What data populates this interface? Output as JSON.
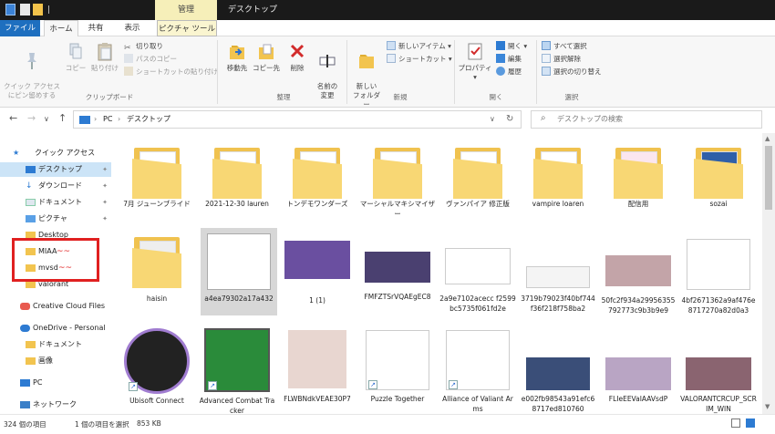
{
  "window": {
    "title": "デスクトップ",
    "context_tab": "管理"
  },
  "tabs": {
    "file": "ファイル",
    "home": "ホーム",
    "share": "共有",
    "view": "表示",
    "picture_tools": "ピクチャ ツール"
  },
  "ribbon": {
    "pin_quick_access": "クイック アクセス\nにピン留めする",
    "copy": "コピー",
    "paste": "貼り付け",
    "cut": "切り取り",
    "copy_path": "パスのコピー",
    "paste_shortcut": "ショートカットの貼り付け",
    "group_clipboard": "クリップボード",
    "move_to": "移動先",
    "copy_to": "コピー先",
    "delete": "削除",
    "rename": "名前の\n変更",
    "group_organize": "整理",
    "new_folder": "新しい\nフォルダー",
    "new_item": "新しいアイテム",
    "shortcut": "ショートカット",
    "group_new": "新規",
    "properties": "プロパティ",
    "open": "開く",
    "edit": "編集",
    "history": "履歴",
    "group_open": "開く",
    "select_all": "すべて選択",
    "select_none": "選択解除",
    "invert_selection": "選択の切り替え",
    "group_select": "選択"
  },
  "address": {
    "crumbs": [
      "PC",
      "デスクトップ"
    ],
    "search_placeholder": "デスクトップの検索"
  },
  "nav": {
    "quick_access": "クイック アクセス",
    "desktop": "デスクトップ",
    "downloads": "ダウンロード",
    "documents": "ドキュメント",
    "pictures": "ピクチャ",
    "desktop_en": "Desktop",
    "miaa": "MIAA",
    "mvsd": "mvsd",
    "valorant": "valorant",
    "creative_cloud": "Creative Cloud Files",
    "onedrive": "OneDrive - Personal",
    "od_documents": "ドキュメント",
    "od_pictures": "画像",
    "pc": "PC",
    "network": "ネットワーク"
  },
  "items": [
    {
      "label": "7月 ジューンブライド"
    },
    {
      "label": "2021-12-30 lauren"
    },
    {
      "label": "トンデモワンダーズ"
    },
    {
      "label": "マーシャルマキシマイザー"
    },
    {
      "label": "ヴァンパイア 修正版"
    },
    {
      "label": "vampire loaren"
    },
    {
      "label": "配信用"
    },
    {
      "label": "sozai"
    },
    {
      "label": "haisin"
    },
    {
      "label": "a4ea79302a17a432"
    },
    {
      "label": "1 (1)"
    },
    {
      "label": "FMFZTSrVQAEgEC8"
    },
    {
      "label": "2a9e7102acecc f2599bc5735f061fd2e"
    },
    {
      "label": "3719b79023f40bf744f36f218f758ba2"
    },
    {
      "label": "50fc2f934a29956355792773c9b3b9e9"
    },
    {
      "label": "4bf2671362a9af476e8717270a82d0a3"
    },
    {
      "label": "Ubisoft Connect"
    },
    {
      "label": "Advanced Combat Tracker"
    },
    {
      "label": "FLWBNdkVEAE30P7"
    },
    {
      "label": "Puzzle Together"
    },
    {
      "label": "Alliance of Valiant Arms"
    },
    {
      "label": "e002fb98543a91efc68717ed810760"
    },
    {
      "label": "FLIeEEVaIAAVsdP"
    },
    {
      "label": "VALORANTCRCUP_SCRIM_WIN"
    }
  ],
  "status": {
    "count": "324 個の項目",
    "selection": "1 個の項目を選択",
    "size": "853 KB"
  }
}
